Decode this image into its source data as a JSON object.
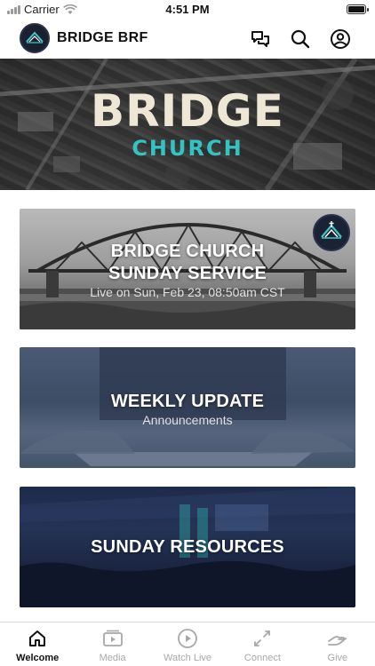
{
  "status_bar": {
    "carrier": "Carrier",
    "time": "4:51 PM"
  },
  "header": {
    "app_title": "BRIDGE BRF",
    "icons": [
      "chat-icon",
      "search-icon",
      "account-icon"
    ]
  },
  "hero": {
    "line1": "BRIDGE",
    "line2": "CHURCH"
  },
  "cards": [
    {
      "title_line1": "BRIDGE CHURCH",
      "title_line2": "SUNDAY SERVICE",
      "subtitle": "Live on Sun, Feb 23, 08:50am CST"
    },
    {
      "title": "WEEKLY UPDATE",
      "subtitle": "Announcements"
    },
    {
      "title": "SUNDAY RESOURCES"
    }
  ],
  "tabs": [
    {
      "label": "Welcome",
      "icon": "home-icon",
      "active": true
    },
    {
      "label": "Media",
      "icon": "media-icon",
      "active": false
    },
    {
      "label": "Watch Live",
      "icon": "play-icon",
      "active": false
    },
    {
      "label": "Connect",
      "icon": "connect-icon",
      "active": false
    },
    {
      "label": "Give",
      "icon": "give-icon",
      "active": false
    }
  ],
  "colors": {
    "accent_teal": "#33c4c2",
    "hero_cream": "#efe7d6",
    "active_tab": "#111111",
    "inactive_tab": "#a8a8a8"
  }
}
